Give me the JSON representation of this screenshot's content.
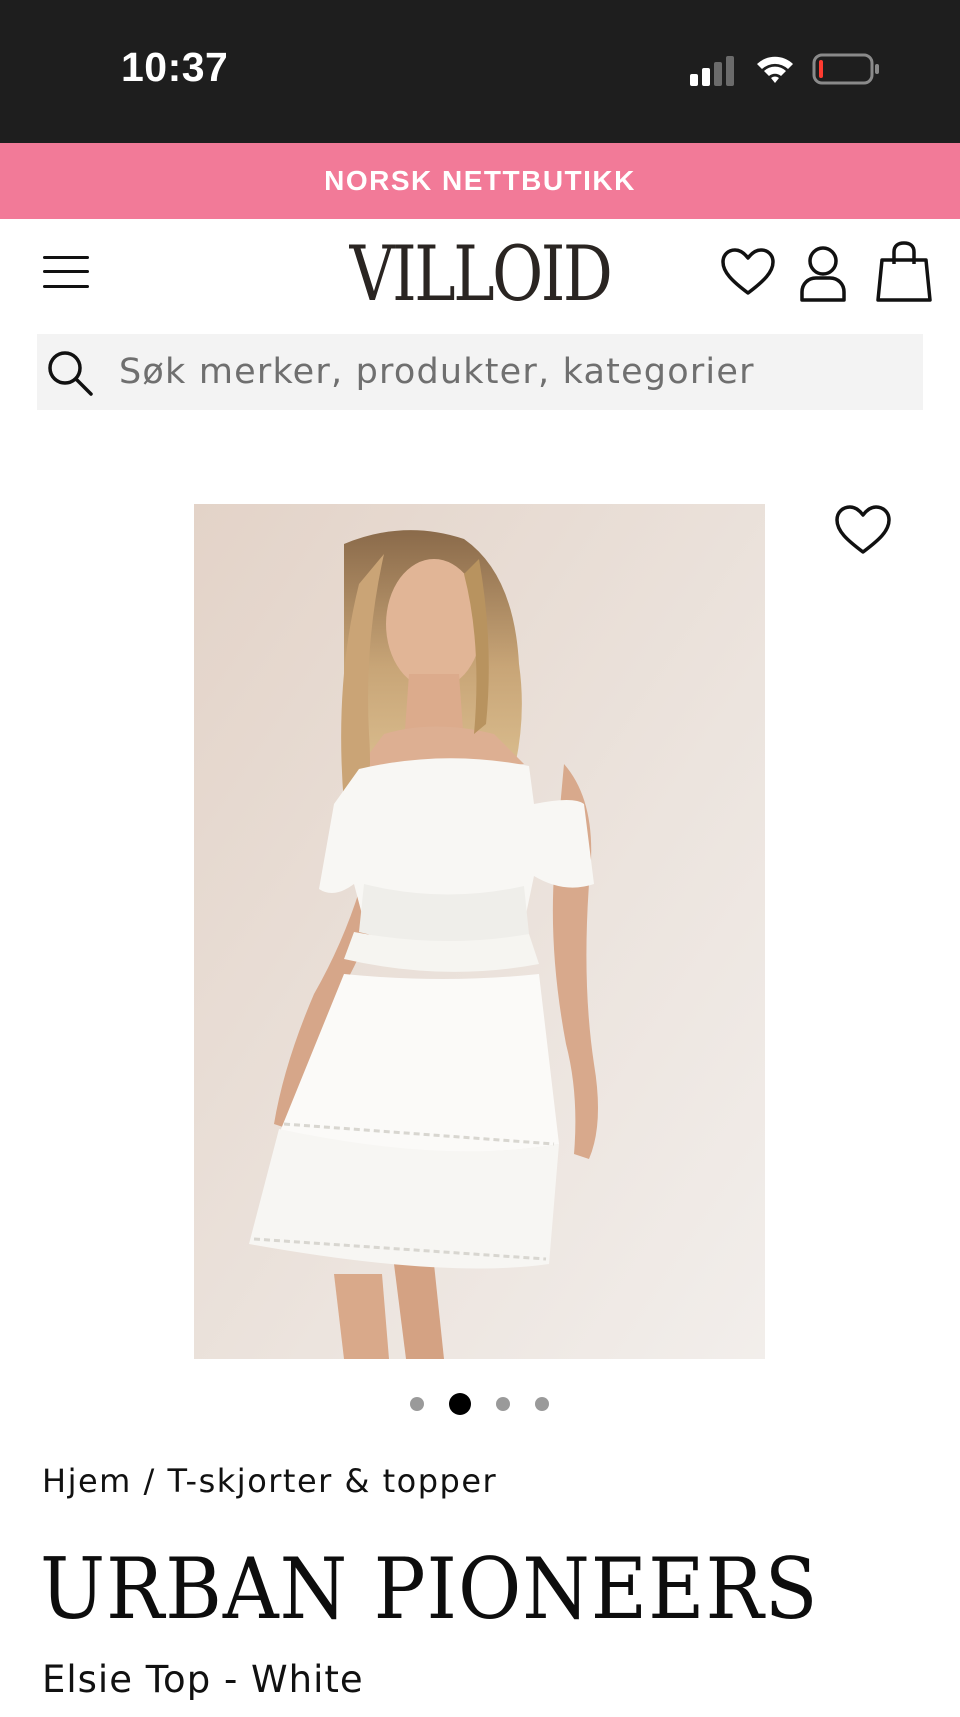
{
  "status_bar": {
    "time": "10:37",
    "icons": [
      "signal-icon",
      "wifi-icon",
      "battery-icon"
    ]
  },
  "promo": {
    "text": "NORSK NETTBUTIKK",
    "background": "#f27a98"
  },
  "header": {
    "logo": "VILLOID",
    "icons": [
      "menu-icon",
      "heart-icon",
      "account-icon",
      "shopping-bag-icon"
    ]
  },
  "search": {
    "placeholder": "Søk merker, produkter, kategorier",
    "value": ""
  },
  "product": {
    "image": "model-in-white-off-shoulder-top-photo",
    "favorite_icon": "heart-icon",
    "carousel": {
      "total": 4,
      "active": 2
    },
    "breadcrumb": {
      "home": "Hjem",
      "separator": " / ",
      "category": "T-skjorter & topper"
    },
    "brand": "URBAN PIONEERS",
    "name": "Elsie Top - White"
  }
}
